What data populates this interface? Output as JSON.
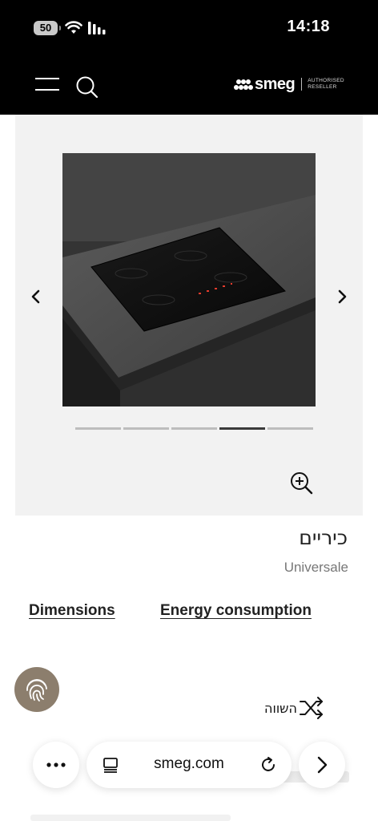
{
  "status_bar": {
    "battery": "50",
    "time": "14:18"
  },
  "header": {
    "menu_icon": "hamburger-menu-icon",
    "search_icon": "search-icon",
    "logo_text": "smeg",
    "logo_sub_line1": "AUTHORISED",
    "logo_sub_line2": "RESELLER"
  },
  "gallery": {
    "slide_count": 5,
    "active_index": 3,
    "prev_icon": "chevron-left-icon",
    "next_icon": "chevron-right-icon",
    "zoom_icon": "zoom-in-icon"
  },
  "product": {
    "title": "כיריים",
    "collection": "Universale"
  },
  "links": {
    "dimensions": "Dimensions",
    "energy": "Energy consumption"
  },
  "compare": {
    "label": "השווה",
    "icon": "shuffle-icon"
  },
  "fingerprint": {
    "icon": "fingerprint-icon",
    "color": "#8c7e6d"
  },
  "browser": {
    "url": "smeg.com",
    "more_icon": "more-dots-icon",
    "tabs_icon": "tabs-icon",
    "reload_icon": "reload-icon",
    "forward_icon": "chevron-right-icon"
  },
  "colors": {
    "header_bg": "#000000",
    "gallery_bg": "#f2f2f2",
    "active_indicator": "#3a3a3a"
  }
}
